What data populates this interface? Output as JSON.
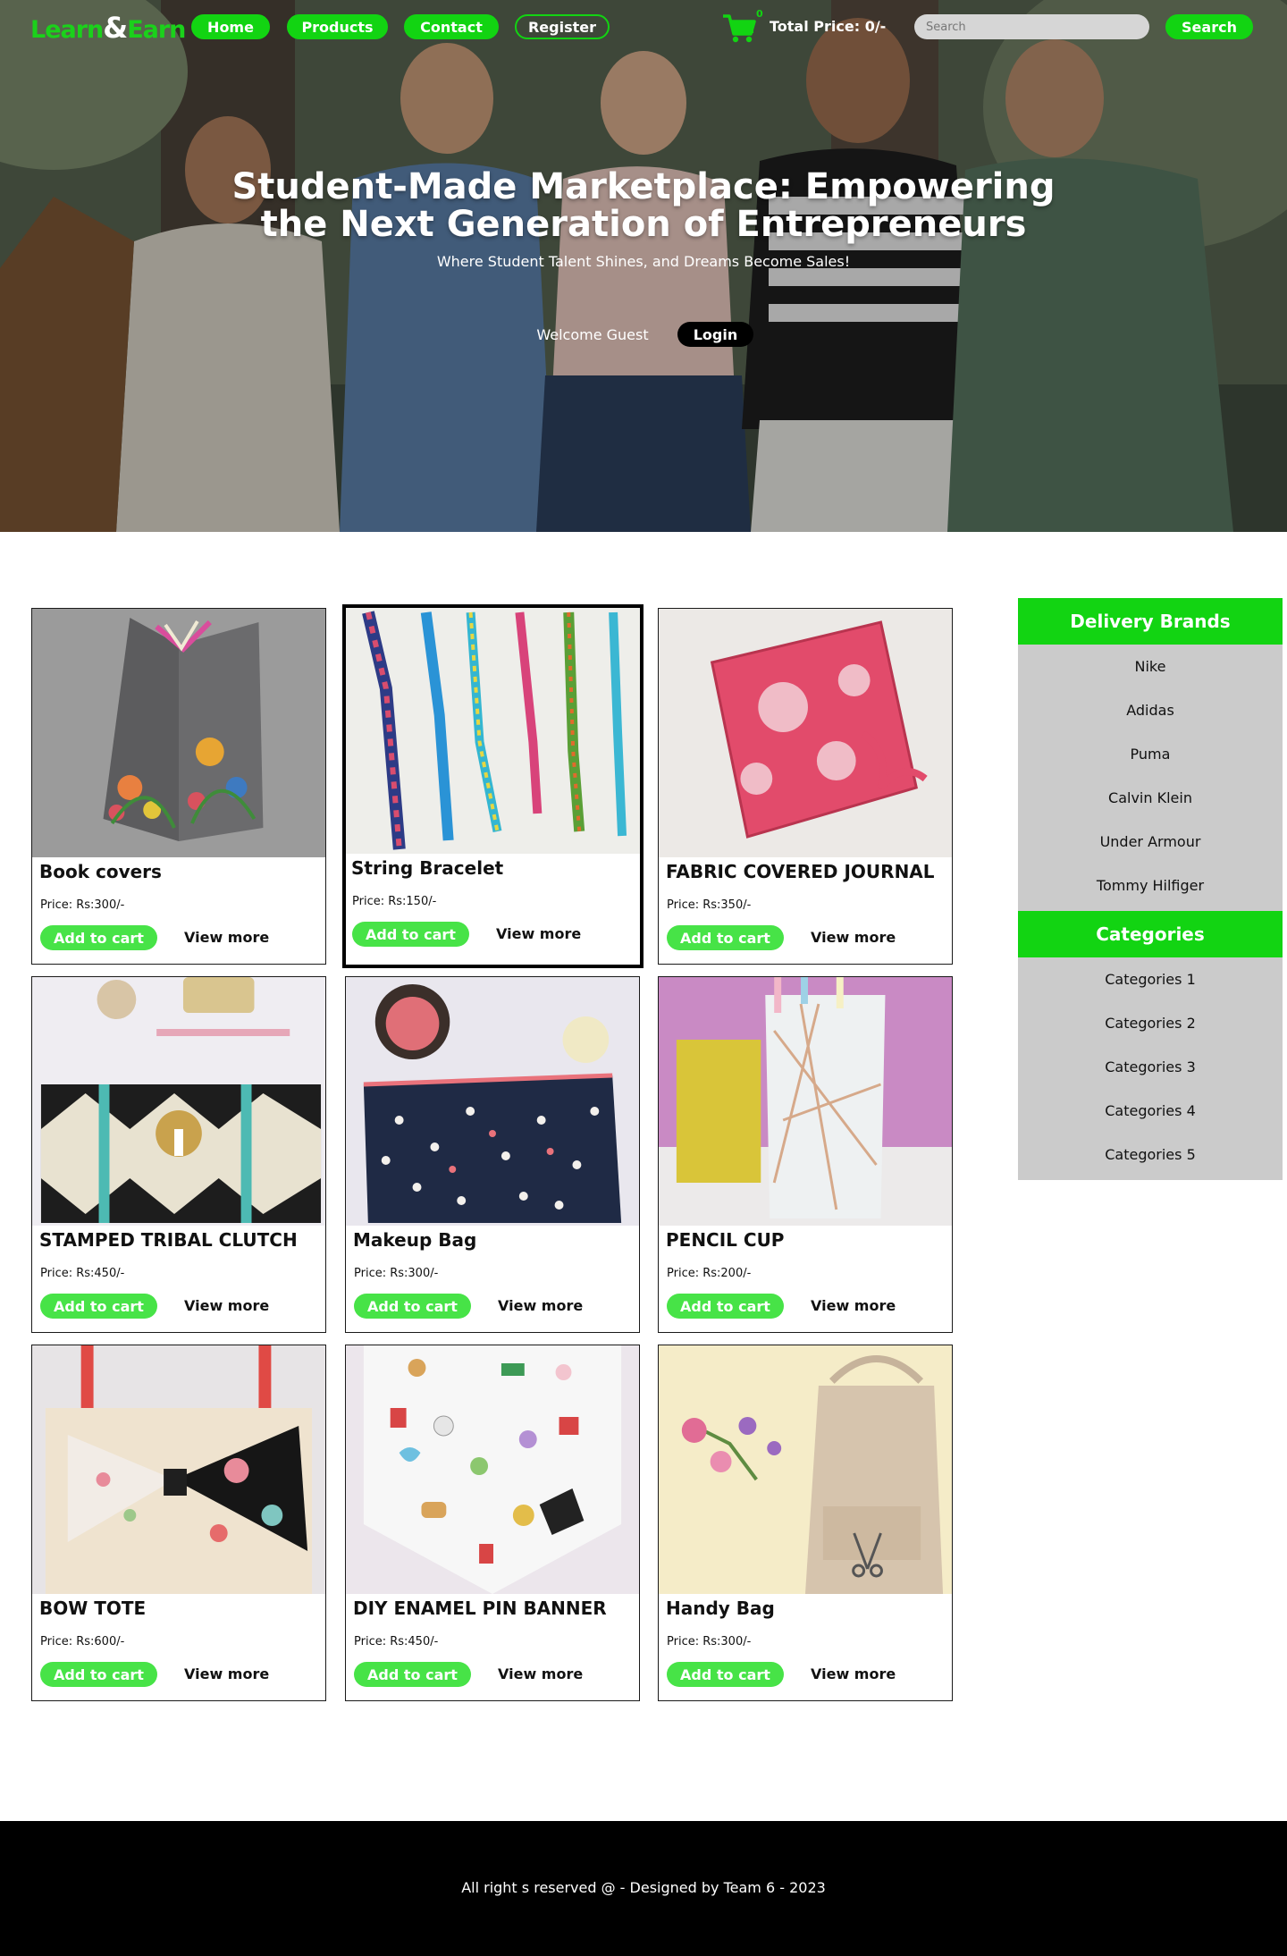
{
  "brand": {
    "logo_left": "Learn",
    "logo_amp": "&",
    "logo_right": "Earn"
  },
  "nav": {
    "home": "Home",
    "products": "Products",
    "contact": "Contact",
    "register": "Register"
  },
  "cart": {
    "count": "0",
    "total_label": "Total Price: 0/-"
  },
  "search": {
    "placeholder": "Search",
    "button_label": "Search"
  },
  "hero": {
    "headline_line1": "Student-Made Marketplace: Empowering",
    "headline_line2": "the Next Generation of Entrepreneurs",
    "tagline": "Where Student Talent Shines, and Dreams Become Sales!",
    "welcome": "Welcome Guest",
    "login_label": "Login"
  },
  "products": [
    {
      "name": "Book covers",
      "price": "Price: Rs:300/-",
      "add_label": "Add to cart",
      "more_label": "View more"
    },
    {
      "name": "String Bracelet",
      "price": "Price: Rs:150/-",
      "add_label": "Add to cart",
      "more_label": "View more"
    },
    {
      "name": "FABRIC COVERED JOURNAL",
      "price": "Price: Rs:350/-",
      "add_label": "Add to cart",
      "more_label": "View more"
    },
    {
      "name": "STAMPED TRIBAL CLUTCH",
      "price": "Price: Rs:450/-",
      "add_label": "Add to cart",
      "more_label": "View more"
    },
    {
      "name": "Makeup Bag",
      "price": "Price: Rs:300/-",
      "add_label": "Add to cart",
      "more_label": "View more"
    },
    {
      "name": "PENCIL CUP",
      "price": "Price: Rs:200/-",
      "add_label": "Add to cart",
      "more_label": "View more"
    },
    {
      "name": "BOW TOTE",
      "price": "Price: Rs:600/-",
      "add_label": "Add to cart",
      "more_label": "View more"
    },
    {
      "name": "DIY ENAMEL PIN BANNER",
      "price": "Price: Rs:450/-",
      "add_label": "Add to cart",
      "more_label": "View more"
    },
    {
      "name": "Handy Bag",
      "price": "Price: Rs:300/-",
      "add_label": "Add to cart",
      "more_label": "View more"
    }
  ],
  "sidebar": {
    "brands_title": "Delivery Brands",
    "brands": [
      "Nike",
      "Adidas",
      "Puma",
      "Calvin Klein",
      "Under Armour",
      "Tommy Hilfiger"
    ],
    "categories_title": "Categories",
    "categories": [
      "Categories 1",
      "Categories 2",
      "Categories 3",
      "Categories 4",
      "Categories 5"
    ]
  },
  "footer": {
    "text": "All right s reserved @ - Designed by Team 6 - 2023"
  },
  "colors": {
    "accent": "#12d412",
    "add_button": "#47e347",
    "sidebar_bg": "#cbcbcb",
    "footer_bg": "#000000"
  }
}
